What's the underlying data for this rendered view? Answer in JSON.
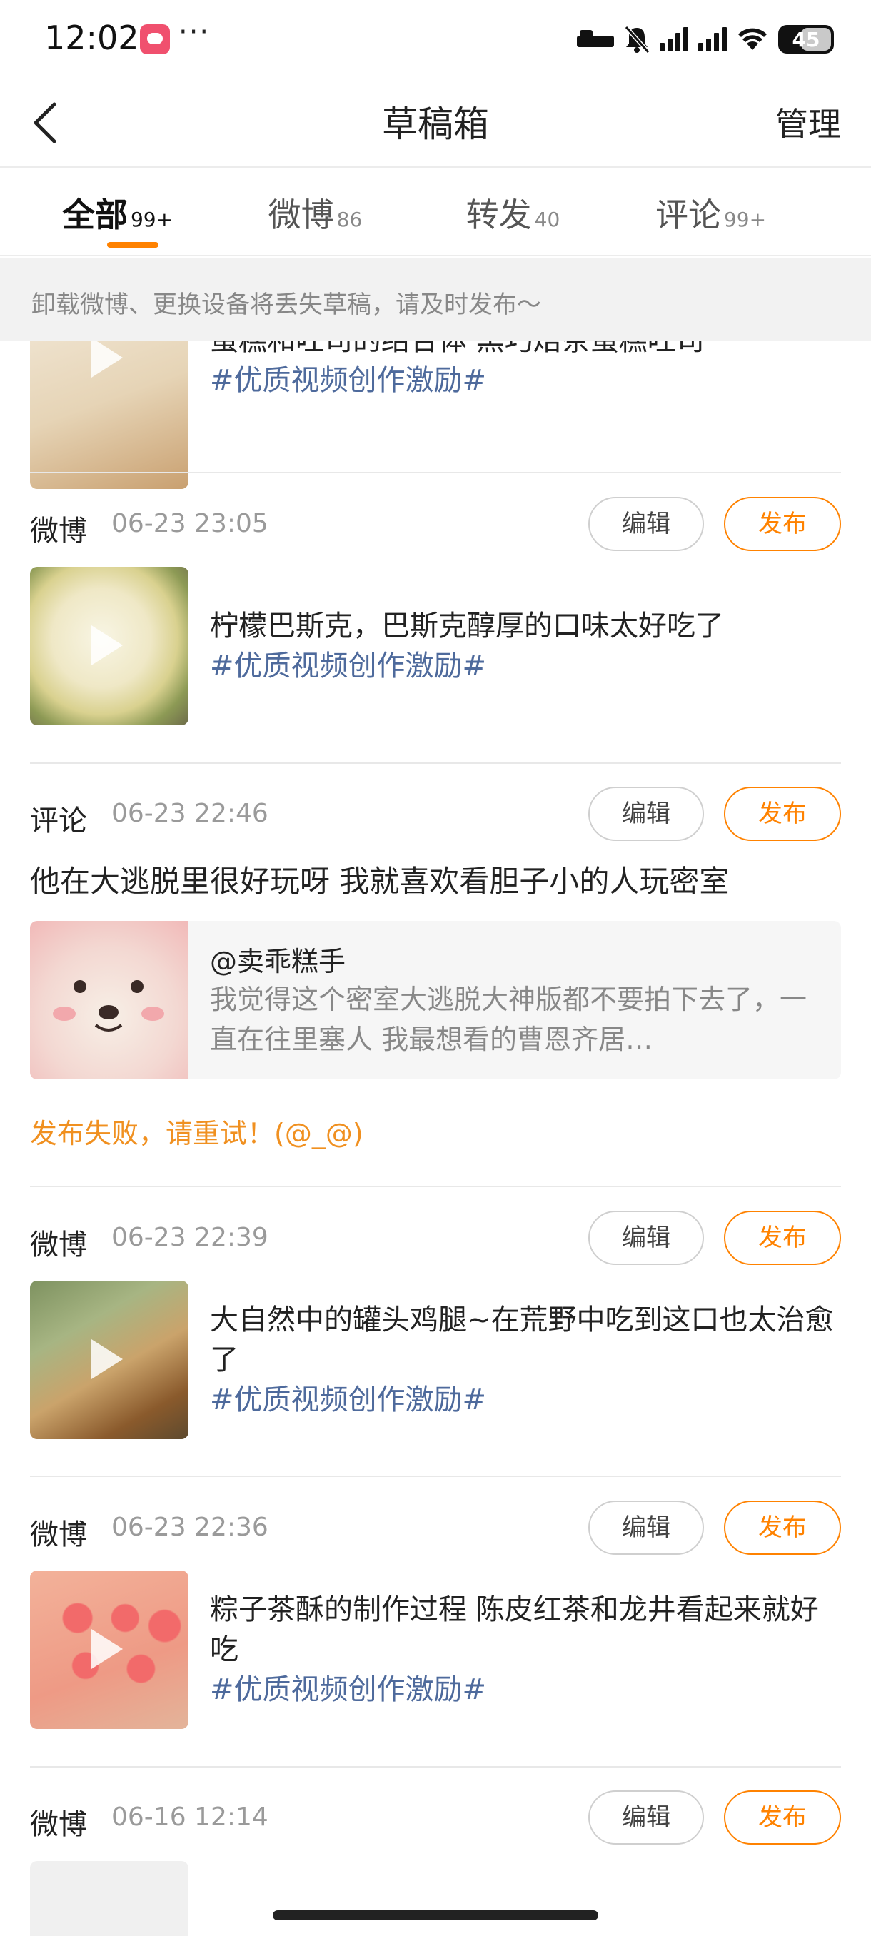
{
  "status_bar": {
    "time": "12:02",
    "dots": "···",
    "battery": "45"
  },
  "nav": {
    "title": "草稿箱",
    "manage_label": "管理"
  },
  "tabs": [
    {
      "label": "全部",
      "count": "99+",
      "active": true
    },
    {
      "label": "微博",
      "count": "86",
      "active": false
    },
    {
      "label": "转发",
      "count": "40",
      "active": false
    },
    {
      "label": "评论",
      "count": "99+",
      "active": false
    }
  ],
  "notice": "卸载微博、更换设备将丢失草稿，请及时发布～",
  "partial_card": {
    "text": "蛋糕和吐司的结合体 黑巧焙茶蛋糕吐司",
    "hashtag": "#优质视频创作激励#"
  },
  "buttons": {
    "edit": "编辑",
    "publish": "发布"
  },
  "cards": [
    {
      "type": "微博",
      "time": "06-23 23:05",
      "text": "柠檬巴斯克，巴斯克醇厚的口味太好吃了",
      "hashtag": "#优质视频创作激励#"
    },
    {
      "type": "评论",
      "time": "06-23 22:46",
      "comment": "他在大逃脱里很好玩呀 我就喜欢看胆子小的人玩密室",
      "quote_author": "@卖乖糕手",
      "quote_text": "我觉得这个密室大逃脱大神版都不要拍下去了，一直在往里塞人 我最想看的曹恩齐居…",
      "fail": "发布失败，请重试！(@_@)"
    },
    {
      "type": "微博",
      "time": "06-23 22:39",
      "text": "大自然中的罐头鸡腿~在荒野中吃到这口也太治愈了",
      "hashtag": "#优质视频创作激励#"
    },
    {
      "type": "微博",
      "time": "06-23 22:36",
      "text": "粽子茶酥的制作过程 陈皮红茶和龙井看起来就好吃",
      "hashtag": "#优质视频创作激励#"
    },
    {
      "type": "微博",
      "time": "06-16 12:14"
    }
  ]
}
